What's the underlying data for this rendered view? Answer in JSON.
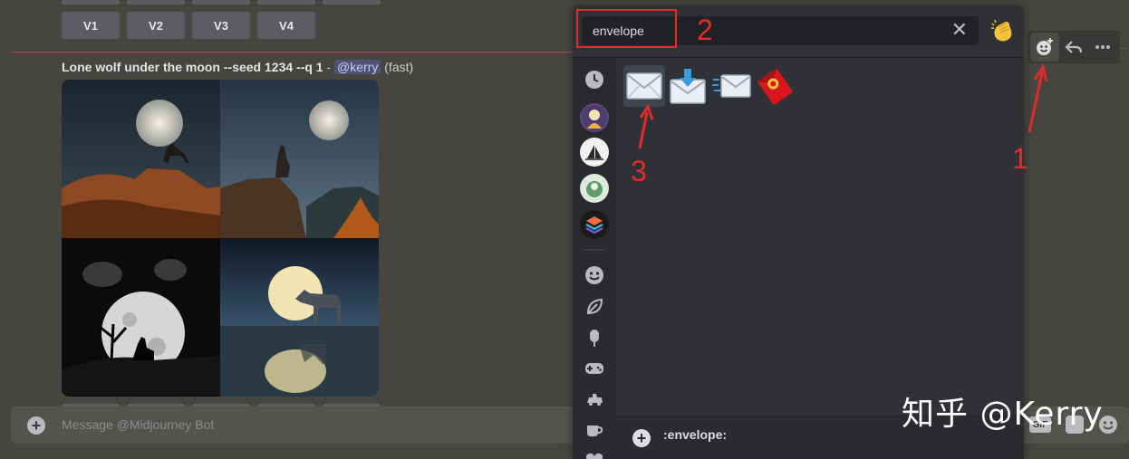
{
  "upscale_buttons": [
    "V1",
    "V2",
    "V3",
    "V4"
  ],
  "message": {
    "prompt": "Lone wolf under the moon --seed 1234 --q 1",
    "separator": " - ",
    "mention": "@kerry",
    "mode": "(fast)"
  },
  "composer": {
    "placeholder": "Message @Midjourney Bot",
    "gif_label": "GIF"
  },
  "toolbar_icons": [
    "add-reaction-icon",
    "reply-icon",
    "more-icon"
  ],
  "emoji_picker": {
    "search_value": "envelope",
    "skin_tone_icon": "clapping-hands-icon",
    "results": [
      {
        "glyph": "✉️",
        "name": "envelope"
      },
      {
        "glyph": "📩",
        "name": "envelope_with_arrow"
      },
      {
        "glyph": "📨",
        "name": "incoming_envelope"
      },
      {
        "glyph": "🧧",
        "name": "red_envelope"
      }
    ],
    "footer_name": ":envelope:",
    "categories": [
      "clock-icon",
      "server-1-avatar",
      "server-2-avatar",
      "server-3-avatar",
      "server-4-avatar",
      "smiley-icon",
      "leaf-icon",
      "food-icon",
      "game-controller-icon",
      "vehicle-icon",
      "cup-icon",
      "heart-icon"
    ]
  },
  "annotations": {
    "one": "1",
    "two": "2",
    "three": "3"
  },
  "watermark": "知乎 @Kerry",
  "colors": {
    "annotation_red": "#e22b2b",
    "mention_bg": "#4f5275"
  }
}
